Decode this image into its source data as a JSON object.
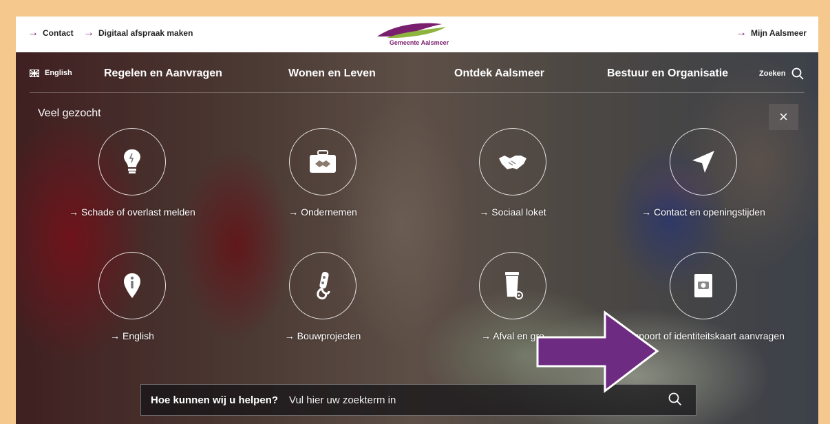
{
  "topbar": {
    "links_left": [
      "Contact",
      "Digitaal afspraak maken"
    ],
    "logo_text": "Gemeente Aalsmeer",
    "link_right": "Mijn Aalsmeer"
  },
  "nav": {
    "language": "English",
    "items": [
      "Regelen en Aanvragen",
      "Wonen en Leven",
      "Ontdek Aalsmeer",
      "Bestuur en Organisatie"
    ],
    "search_label": "Zoeken"
  },
  "popular": {
    "heading": "Veel gezocht",
    "close": "×",
    "tiles": [
      {
        "label": "→ Schade of overlast melden",
        "icon": "lightbulb-icon"
      },
      {
        "label": "→ Ondernemen",
        "icon": "briefcase-icon"
      },
      {
        "label": "→ Sociaal loket",
        "icon": "handshake-icon"
      },
      {
        "label": "→ Contact en openingstijden",
        "icon": "location-arrow-icon"
      },
      {
        "label": "→ English",
        "icon": "info-icon"
      },
      {
        "label": "→ Bouwprojecten",
        "icon": "crane-hook-icon"
      },
      {
        "label": "→ Afval en gro",
        "icon": "waste-bin-icon"
      },
      {
        "label": "Paspoort of identiteitskaart aanvragen",
        "icon": "passport-icon"
      }
    ]
  },
  "search": {
    "label": "Hoe kunnen wij u helpen?",
    "placeholder": "Vul hier uw zoekterm in"
  },
  "colors": {
    "brand": "#7a1f6e",
    "frame": "#f5c98e",
    "annotation_arrow": "#6e2b82"
  }
}
